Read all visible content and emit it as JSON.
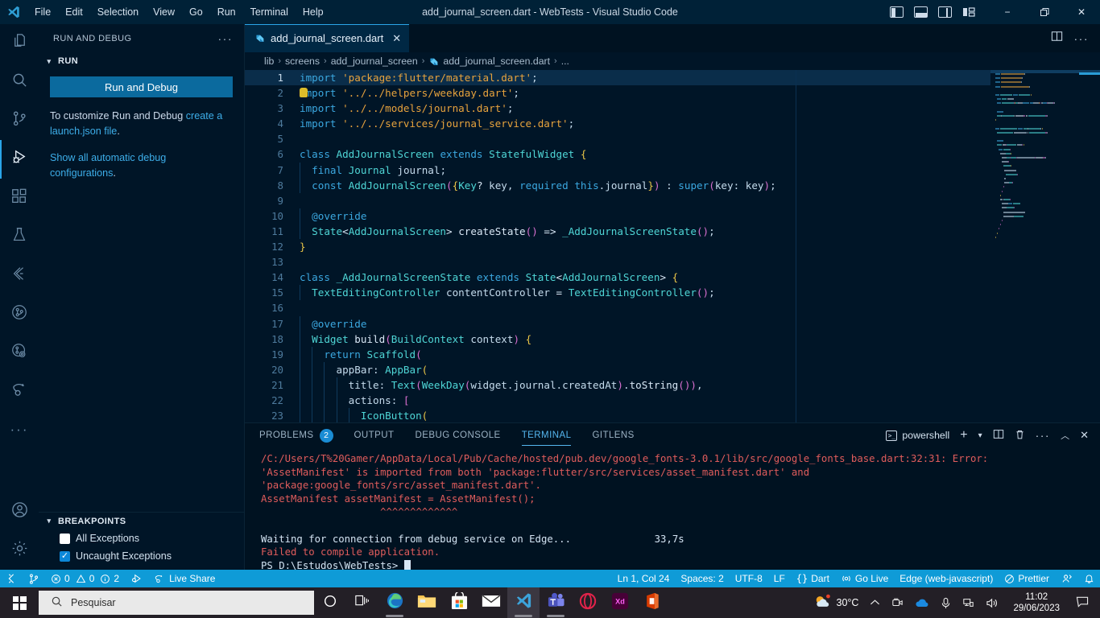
{
  "titlebar": {
    "logo_icon": "vscode-logo",
    "menus": [
      "File",
      "Edit",
      "Selection",
      "View",
      "Go",
      "Run",
      "Terminal",
      "Help"
    ],
    "window_title": "add_journal_screen.dart - WebTests - Visual Studio Code",
    "layout_toggles": [
      "toggle-primary-sidebar-icon",
      "toggle-panel-icon",
      "toggle-secondary-sidebar-icon",
      "customize-layout-icon"
    ],
    "minimize": "−",
    "maximize": "❐",
    "close": "✕"
  },
  "activitybar": {
    "items": [
      {
        "name": "explorer",
        "icon": "files-icon"
      },
      {
        "name": "search",
        "icon": "search-icon"
      },
      {
        "name": "source-control",
        "icon": "source-control-icon"
      },
      {
        "name": "run-and-debug",
        "icon": "run-debug-icon",
        "active": true
      },
      {
        "name": "extensions",
        "icon": "extensions-icon"
      },
      {
        "name": "testing",
        "icon": "beaker-icon"
      },
      {
        "name": "flutter",
        "icon": "flutter-icon"
      },
      {
        "name": "gitlens",
        "icon": "gitlens-icon"
      },
      {
        "name": "gitlens-inspect",
        "icon": "gitlens-inspect-icon"
      },
      {
        "name": "live-share",
        "icon": "live-share-icon"
      },
      {
        "name": "more-views",
        "icon": "ellipsis-icon"
      }
    ],
    "bottom_items": [
      {
        "name": "accounts",
        "icon": "account-icon"
      },
      {
        "name": "manage",
        "icon": "gear-icon"
      }
    ]
  },
  "sidebar": {
    "title": "RUN AND DEBUG",
    "more_actions": "···",
    "section_label": "RUN",
    "run_button": "Run and Debug",
    "customize_text_part1": "To customize Run and Debug ",
    "customize_link": "create a launch.json file",
    "customize_text_part2": ".",
    "automatic_link": "Show all automatic debug configurations",
    "automatic_suffix": ".",
    "breakpoints_label": "BREAKPOINTS",
    "breakpoints": [
      {
        "label": "All Exceptions",
        "checked": false
      },
      {
        "label": "Uncaught Exceptions",
        "checked": true
      }
    ]
  },
  "editor": {
    "tab": {
      "label": "add_journal_screen.dart",
      "icon": "dart-file-icon",
      "close": "✕"
    },
    "tab_actions": [
      "split-editor-icon",
      "more-actions-icon"
    ],
    "breadcrumbs": [
      "lib",
      "screens",
      "add_journal_screen",
      "add_journal_screen.dart",
      "..."
    ],
    "breadcrumb_separator": "›",
    "active_line": 1,
    "lines": [
      {
        "n": 1,
        "tokens": [
          [
            "kw",
            "import"
          ],
          [
            "plain",
            " "
          ],
          [
            "str",
            "'package:flutter/material.dart'"
          ],
          [
            "punct",
            ";"
          ]
        ]
      },
      {
        "n": 2,
        "tokens": [
          [
            "kw",
            "import"
          ],
          [
            "plain",
            " "
          ],
          [
            "str",
            "'../../helpers/weekday.dart'"
          ],
          [
            "punct",
            ";"
          ]
        ],
        "bulb": true
      },
      {
        "n": 3,
        "tokens": [
          [
            "kw",
            "import"
          ],
          [
            "plain",
            " "
          ],
          [
            "str",
            "'../../models/journal.dart'"
          ],
          [
            "punct",
            ";"
          ]
        ]
      },
      {
        "n": 4,
        "tokens": [
          [
            "kw",
            "import"
          ],
          [
            "plain",
            " "
          ],
          [
            "str",
            "'../../services/journal_service.dart'"
          ],
          [
            "punct",
            ";"
          ]
        ]
      },
      {
        "n": 5,
        "tokens": []
      },
      {
        "n": 6,
        "tokens": [
          [
            "kw",
            "class"
          ],
          [
            "plain",
            " "
          ],
          [
            "type",
            "AddJournalScreen"
          ],
          [
            "plain",
            " "
          ],
          [
            "kw",
            "extends"
          ],
          [
            "plain",
            " "
          ],
          [
            "type",
            "StatefulWidget"
          ],
          [
            "plain",
            " "
          ],
          [
            "brace1",
            "{"
          ]
        ]
      },
      {
        "n": 7,
        "tokens": [
          [
            "plain",
            "  "
          ],
          [
            "kw",
            "final"
          ],
          [
            "plain",
            " "
          ],
          [
            "type",
            "Journal"
          ],
          [
            "plain",
            " "
          ],
          [
            "var",
            "journal"
          ],
          [
            "punct",
            ";"
          ]
        ]
      },
      {
        "n": 8,
        "tokens": [
          [
            "plain",
            "  "
          ],
          [
            "kw",
            "const"
          ],
          [
            "plain",
            " "
          ],
          [
            "type",
            "AddJournalScreen"
          ],
          [
            "brace2",
            "("
          ],
          [
            "brace3",
            "{"
          ],
          [
            "type",
            "Key"
          ],
          [
            "op",
            "?"
          ],
          [
            "plain",
            " "
          ],
          [
            "var",
            "key"
          ],
          [
            "punct",
            ", "
          ],
          [
            "kw",
            "required"
          ],
          [
            "plain",
            " "
          ],
          [
            "kw2",
            "this"
          ],
          [
            "punct",
            "."
          ],
          [
            "var",
            "journal"
          ],
          [
            "brace3",
            "}"
          ],
          [
            "brace2",
            ")"
          ],
          [
            "plain",
            " "
          ],
          [
            "punct",
            ": "
          ],
          [
            "kw2",
            "super"
          ],
          [
            "brace2",
            "("
          ],
          [
            "var",
            "key"
          ],
          [
            "punct",
            ": "
          ],
          [
            "var",
            "key"
          ],
          [
            "brace2",
            ")"
          ],
          [
            "punct",
            ";"
          ]
        ]
      },
      {
        "n": 9,
        "tokens": []
      },
      {
        "n": 10,
        "tokens": [
          [
            "plain",
            "  "
          ],
          [
            "anno",
            "@override"
          ]
        ]
      },
      {
        "n": 11,
        "tokens": [
          [
            "plain",
            "  "
          ],
          [
            "type",
            "State"
          ],
          [
            "op",
            "<"
          ],
          [
            "type",
            "AddJournalScreen"
          ],
          [
            "op",
            ">"
          ],
          [
            "plain",
            " "
          ],
          [
            "fn",
            "createState"
          ],
          [
            "brace2",
            "()"
          ],
          [
            "plain",
            " "
          ],
          [
            "op",
            "=>"
          ],
          [
            "plain",
            " "
          ],
          [
            "type2",
            "_AddJournalScreenState"
          ],
          [
            "brace2",
            "()"
          ],
          [
            "punct",
            ";"
          ]
        ]
      },
      {
        "n": 12,
        "tokens": [
          [
            "brace1",
            "}"
          ]
        ]
      },
      {
        "n": 13,
        "tokens": []
      },
      {
        "n": 14,
        "tokens": [
          [
            "kw",
            "class"
          ],
          [
            "plain",
            " "
          ],
          [
            "type2",
            "_AddJournalScreenState"
          ],
          [
            "plain",
            " "
          ],
          [
            "kw",
            "extends"
          ],
          [
            "plain",
            " "
          ],
          [
            "type",
            "State"
          ],
          [
            "op",
            "<"
          ],
          [
            "type",
            "AddJournalScreen"
          ],
          [
            "op",
            ">"
          ],
          [
            "plain",
            " "
          ],
          [
            "brace1",
            "{"
          ]
        ]
      },
      {
        "n": 15,
        "tokens": [
          [
            "plain",
            "  "
          ],
          [
            "type",
            "TextEditingController"
          ],
          [
            "plain",
            " "
          ],
          [
            "var",
            "contentController"
          ],
          [
            "plain",
            " "
          ],
          [
            "op",
            "="
          ],
          [
            "plain",
            " "
          ],
          [
            "type",
            "TextEditingController"
          ],
          [
            "brace2",
            "()"
          ],
          [
            "punct",
            ";"
          ]
        ]
      },
      {
        "n": 16,
        "tokens": []
      },
      {
        "n": 17,
        "tokens": [
          [
            "plain",
            "  "
          ],
          [
            "anno",
            "@override"
          ]
        ]
      },
      {
        "n": 18,
        "tokens": [
          [
            "plain",
            "  "
          ],
          [
            "type",
            "Widget"
          ],
          [
            "plain",
            " "
          ],
          [
            "fn",
            "build"
          ],
          [
            "brace2",
            "("
          ],
          [
            "type",
            "BuildContext"
          ],
          [
            "plain",
            " "
          ],
          [
            "var",
            "context"
          ],
          [
            "brace2",
            ")"
          ],
          [
            "plain",
            " "
          ],
          [
            "brace3",
            "{"
          ]
        ]
      },
      {
        "n": 19,
        "tokens": [
          [
            "plain",
            "    "
          ],
          [
            "kw",
            "return"
          ],
          [
            "plain",
            " "
          ],
          [
            "type",
            "Scaffold"
          ],
          [
            "brace2",
            "("
          ]
        ]
      },
      {
        "n": 20,
        "tokens": [
          [
            "plain",
            "      "
          ],
          [
            "var",
            "appBar"
          ],
          [
            "punct",
            ": "
          ],
          [
            "type",
            "AppBar"
          ],
          [
            "brace3",
            "("
          ]
        ]
      },
      {
        "n": 21,
        "tokens": [
          [
            "plain",
            "        "
          ],
          [
            "var",
            "title"
          ],
          [
            "punct",
            ": "
          ],
          [
            "type",
            "Text"
          ],
          [
            "brace2",
            "("
          ],
          [
            "type",
            "WeekDay"
          ],
          [
            "brace4",
            "("
          ],
          [
            "var",
            "widget"
          ],
          [
            "punct",
            "."
          ],
          [
            "var",
            "journal"
          ],
          [
            "punct",
            "."
          ],
          [
            "var",
            "createdAt"
          ],
          [
            "brace4",
            ")"
          ],
          [
            "punct",
            "."
          ],
          [
            "fn",
            "toString"
          ],
          [
            "brace4",
            "()"
          ],
          [
            "brace2",
            ")"
          ],
          [
            "punct",
            ","
          ]
        ]
      },
      {
        "n": 22,
        "tokens": [
          [
            "plain",
            "        "
          ],
          [
            "var",
            "actions"
          ],
          [
            "punct",
            ": "
          ],
          [
            "brace2",
            "["
          ]
        ]
      },
      {
        "n": 23,
        "tokens": [
          [
            "plain",
            "          "
          ],
          [
            "type",
            "IconButton"
          ],
          [
            "brace3",
            "("
          ]
        ]
      }
    ]
  },
  "panel": {
    "tabs": [
      {
        "label": "PROBLEMS",
        "badge": "2",
        "active": false
      },
      {
        "label": "OUTPUT",
        "active": false
      },
      {
        "label": "DEBUG CONSOLE",
        "active": false
      },
      {
        "label": "TERMINAL",
        "active": true
      },
      {
        "label": "GITLENS",
        "active": false
      }
    ],
    "shell_name": "powershell",
    "shell_icon": "terminal-icon",
    "actions": [
      "new-terminal-icon",
      "terminal-dropdown-icon",
      "split-terminal-icon",
      "kill-terminal-icon",
      "more-actions-icon",
      "maximize-panel-icon",
      "close-panel-icon"
    ],
    "terminal_lines": [
      {
        "text": "/C:/Users/T%20Gamer/AppData/Local/Pub/Cache/hosted/pub.dev/google_fonts-3.0.1/lib/src/google_fonts_base.dart:32:31: Error:",
        "type": "error"
      },
      {
        "text": "'AssetManifest' is imported from both 'package:flutter/src/services/asset_manifest.dart' and",
        "type": "error"
      },
      {
        "text": "'package:google_fonts/src/asset_manifest.dart'.",
        "type": "error"
      },
      {
        "text": "AssetManifest assetManifest = AssetManifest();",
        "type": "error"
      },
      {
        "text": "                    ^^^^^^^^^^^^^",
        "type": "error"
      },
      {
        "text": "",
        "type": "normal"
      },
      {
        "text": "Waiting for connection from debug service on Edge...              33,7s",
        "type": "normal"
      },
      {
        "text": "Failed to compile application.",
        "type": "error"
      },
      {
        "text": "PS D:\\Estudos\\WebTests> ",
        "type": "prompt"
      }
    ]
  },
  "statusbar": {
    "left": [
      {
        "name": "remote-window",
        "icon": "remote-icon",
        "label": ""
      },
      {
        "name": "git-branch",
        "icon": "git-branch-icon",
        "label": ""
      },
      {
        "name": "problems",
        "label": "0  0  2",
        "errors": "0",
        "warnings": "0",
        "infos": "2"
      },
      {
        "name": "debug-start",
        "icon": "debug-icon",
        "label": ""
      },
      {
        "name": "live-share",
        "icon": "live-share-icon",
        "label": "Live Share"
      }
    ],
    "right": [
      {
        "name": "cursor-position",
        "label": "Ln 1, Col 24"
      },
      {
        "name": "indentation",
        "label": "Spaces: 2"
      },
      {
        "name": "encoding",
        "label": "UTF-8"
      },
      {
        "name": "eol",
        "label": "LF"
      },
      {
        "name": "language-mode",
        "label": "Dart",
        "icon": "brackets-icon"
      },
      {
        "name": "go-live",
        "label": "Go Live",
        "icon": "broadcast-icon"
      },
      {
        "name": "debug-target",
        "label": "Edge (web-javascript)"
      },
      {
        "name": "prettier",
        "label": "Prettier",
        "icon": "prettier-icon"
      },
      {
        "name": "gitlens-toggle",
        "label": "",
        "icon": "gitlens-person-icon"
      },
      {
        "name": "notifications",
        "label": "",
        "icon": "bell-icon"
      }
    ]
  },
  "taskbar": {
    "start_icon": "windows-start-icon",
    "search_placeholder": "Pesquisar",
    "search_icon": "search-icon",
    "items": [
      {
        "name": "cortana",
        "icon": "cortana-icon"
      },
      {
        "name": "task-view",
        "icon": "task-view-icon"
      },
      {
        "name": "microsoft-edge",
        "icon": "edge-icon",
        "running": true
      },
      {
        "name": "file-explorer",
        "icon": "folder-icon"
      },
      {
        "name": "microsoft-store",
        "icon": "store-icon"
      },
      {
        "name": "mail",
        "icon": "mail-icon"
      },
      {
        "name": "visual-studio-code",
        "icon": "vscode-icon",
        "running": true,
        "active": true
      },
      {
        "name": "microsoft-teams",
        "icon": "teams-icon",
        "running": true
      },
      {
        "name": "opera",
        "icon": "opera-icon"
      },
      {
        "name": "adobe-xd",
        "icon": "xd-icon"
      },
      {
        "name": "microsoft-office",
        "icon": "office-icon"
      }
    ],
    "weather": {
      "temp": "30°C",
      "icon": "sun-cloud-icon"
    },
    "tray": [
      "show-hidden-icons",
      "camera-icon",
      "onedrive-icon",
      "microphone-icon",
      "network-icon",
      "volume-icon"
    ],
    "clock_time": "11:02",
    "clock_date": "29/06/2023",
    "notification_icon": "notification-icon"
  },
  "colors": {
    "accent": "#0f9bd7",
    "editor_bg": "#001527",
    "panel_bg": "#001221",
    "error": "#e05c5c",
    "keyword": "#3ba8e0",
    "string": "#e6a23c",
    "type": "#4fd6d6"
  }
}
